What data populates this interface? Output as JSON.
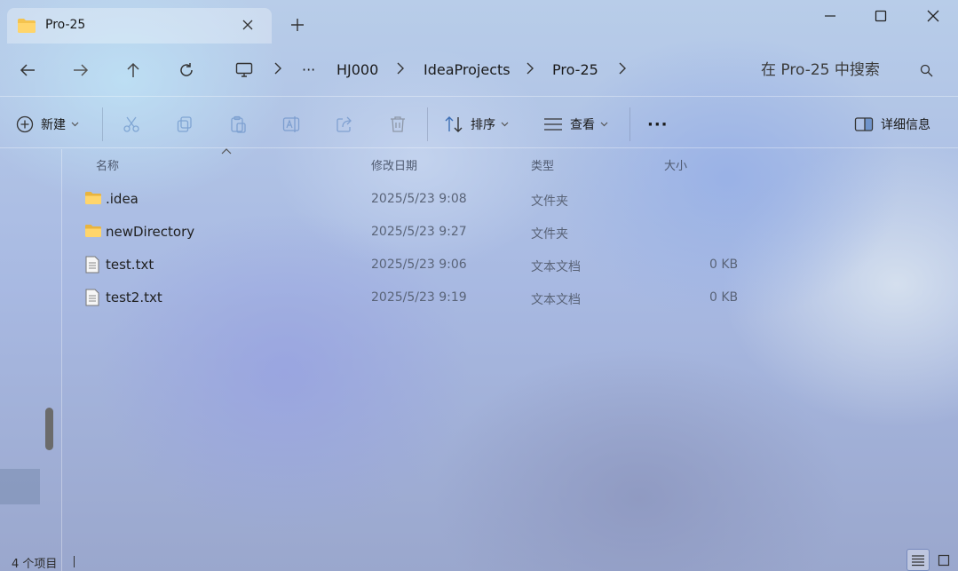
{
  "window": {
    "tab_title": "Pro-25",
    "new_tab_symbol": "+",
    "controls": [
      "minimize-icon",
      "maximize-icon",
      "close-icon"
    ]
  },
  "address": {
    "nav_icons": [
      "back-icon",
      "forward-icon",
      "up-icon",
      "refresh-icon",
      "this-pc-icon"
    ],
    "ellipsis": "···",
    "breadcrumbs": [
      "HJ000",
      "IdeaProjects",
      "Pro-25"
    ],
    "search_placeholder": "在 Pro-25 中搜索"
  },
  "toolbar": {
    "new_label": "新建",
    "sort_label": "排序",
    "view_label": "查看",
    "more_label": "···",
    "details_label": "详细信息",
    "action_icons": [
      "cut-icon",
      "copy-icon",
      "paste-icon",
      "rename-icon",
      "share-icon",
      "delete-icon"
    ]
  },
  "columns": {
    "name": "名称",
    "modified": "修改日期",
    "type": "类型",
    "size": "大小"
  },
  "files": [
    {
      "name": ".idea",
      "modified": "2025/5/23 9:08",
      "type": "文件夹",
      "size": "",
      "icon": "folder-icon"
    },
    {
      "name": "newDirectory",
      "modified": "2025/5/23 9:27",
      "type": "文件夹",
      "size": "",
      "icon": "folder-icon"
    },
    {
      "name": "test.txt",
      "modified": "2025/5/23 9:06",
      "type": "文本文档",
      "size": "0 KB",
      "icon": "text-file-icon"
    },
    {
      "name": "test2.txt",
      "modified": "2025/5/23 9:19",
      "type": "文本文档",
      "size": "0 KB",
      "icon": "text-file-icon"
    }
  ],
  "status": {
    "item_count": "4 个项目"
  },
  "colors": {
    "folder": "#f4c34e",
    "accent": "#3d6fb5"
  }
}
